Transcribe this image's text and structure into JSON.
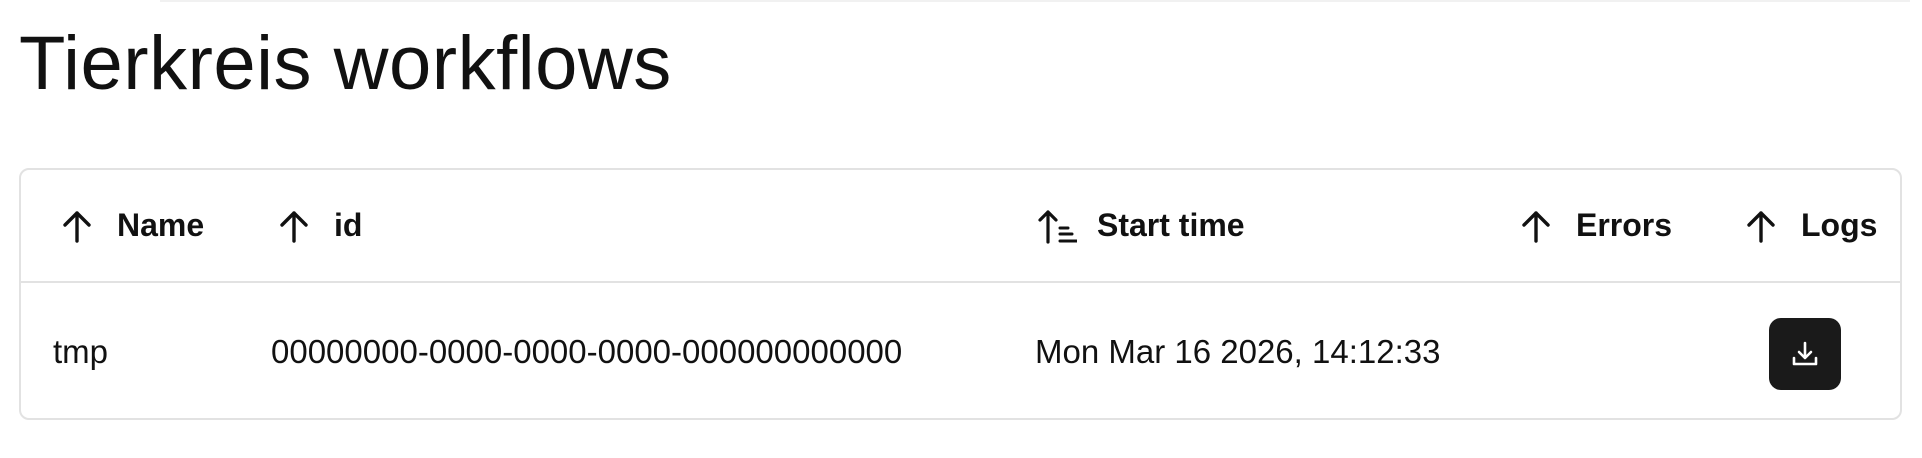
{
  "page": {
    "title": "Tierkreis workflows"
  },
  "table": {
    "columns": [
      {
        "label": "Name",
        "sort_icon": "arrow-up-icon"
      },
      {
        "label": "id",
        "sort_icon": "arrow-up-icon"
      },
      {
        "label": "Start time",
        "sort_icon": "sort-ascending-icon"
      },
      {
        "label": "Errors",
        "sort_icon": "arrow-up-icon"
      },
      {
        "label": "Logs",
        "sort_icon": "arrow-up-icon"
      }
    ],
    "rows": [
      {
        "name": "tmp",
        "id": "00000000-0000-0000-0000-000000000000",
        "start_time": "Mon Mar 16 2026, 14:12:33",
        "errors": "",
        "logs_icon": "download-icon"
      }
    ]
  },
  "colors": {
    "border": "#e2e2e2",
    "button_bg": "#1a1a1a",
    "text": "#111111"
  }
}
